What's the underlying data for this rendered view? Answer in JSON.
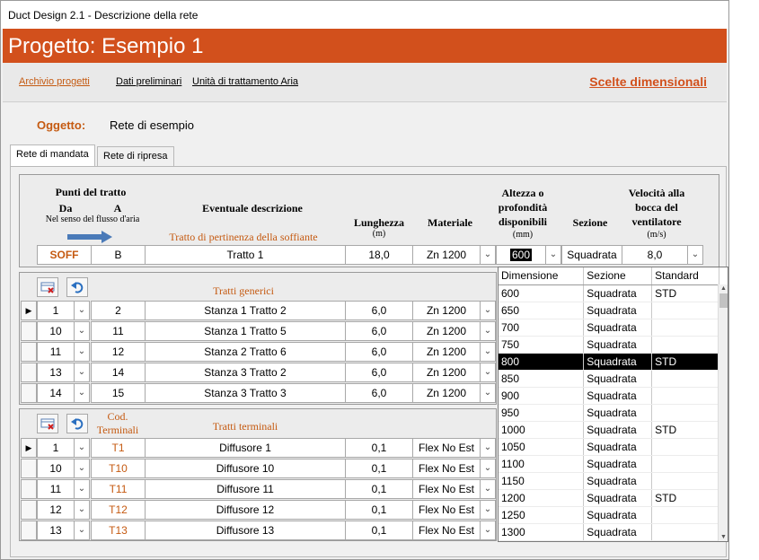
{
  "window": {
    "title": "Duct Design 2.1 - Descrizione della rete"
  },
  "banner": {
    "title": "Progetto: Esempio 1"
  },
  "nav": {
    "items": [
      "Archivio progetti",
      "Dati preliminari",
      "Unità di trattamento Aria"
    ],
    "right": "Scelte dimensionali"
  },
  "oggetto": {
    "label": "Oggetto:",
    "value": "Rete di esempio"
  },
  "tabs": [
    "Rete di mandata",
    "Rete di ripresa"
  ],
  "header": {
    "punti": "Punti del tratto",
    "da": "Da",
    "a": "A",
    "senso": "Nel senso del flusso d'aria",
    "descrizione": "Eventuale descrizione",
    "pertinenza": "Tratto di pertinenza della soffiante",
    "lunghezza": "Lunghezza",
    "lunghezza_unit": "(m)",
    "materiale": "Materiale",
    "altezza": "Altezza o profondità disponibili",
    "altezza_unit": "(mm)",
    "sezione": "Sezione",
    "velocita": "Velocità alla bocca del ventilatore",
    "velocita_unit": "(m/s)"
  },
  "fan_row": {
    "da": "SOFF",
    "a": "B",
    "descrizione": "Tratto 1",
    "lunghezza": "18,0",
    "materiale": "Zn 1200",
    "altezza": "600",
    "sezione": "Squadrata",
    "velocita": "8,0"
  },
  "generici": {
    "title": "Tratti generici",
    "rows": [
      {
        "da": "1",
        "a": "2",
        "desc": "Stanza 1 Tratto 2",
        "len": "6,0",
        "mat": "Zn 1200"
      },
      {
        "da": "10",
        "a": "11",
        "desc": "Stanza 1 Tratto 5",
        "len": "6,0",
        "mat": "Zn 1200"
      },
      {
        "da": "11",
        "a": "12",
        "desc": "Stanza 2 Tratto 6",
        "len": "6,0",
        "mat": "Zn 1200"
      },
      {
        "da": "13",
        "a": "14",
        "desc": "Stanza 3 Tratto 2",
        "len": "6,0",
        "mat": "Zn 1200"
      },
      {
        "da": "14",
        "a": "15",
        "desc": "Stanza 3 Tratto 3",
        "len": "6,0",
        "mat": "Zn 1200"
      }
    ]
  },
  "terminali": {
    "title": "Tratti terminali",
    "cod": "Cod. Terminali",
    "rows": [
      {
        "da": "1",
        "cod": "T1",
        "desc": "Diffusore 1",
        "val": "0,1",
        "tipo": "Flex No Est"
      },
      {
        "da": "10",
        "cod": "T10",
        "desc": "Diffusore 10",
        "val": "0,1",
        "tipo": "Flex No Est"
      },
      {
        "da": "11",
        "cod": "T11",
        "desc": "Diffusore 11",
        "val": "0,1",
        "tipo": "Flex No Est"
      },
      {
        "da": "12",
        "cod": "T12",
        "desc": "Diffusore 12",
        "val": "0,1",
        "tipo": "Flex No Est"
      },
      {
        "da": "13",
        "cod": "T13",
        "desc": "Diffusore 13",
        "val": "0,1",
        "tipo": "Flex No Est"
      }
    ]
  },
  "dropdown": {
    "columns": [
      "Dimensione",
      "Sezione",
      "Standard"
    ],
    "rows": [
      [
        "600",
        "Squadrata",
        "STD"
      ],
      [
        "650",
        "Squadrata",
        ""
      ],
      [
        "700",
        "Squadrata",
        ""
      ],
      [
        "750",
        "Squadrata",
        ""
      ],
      [
        "800",
        "Squadrata",
        "STD"
      ],
      [
        "850",
        "Squadrata",
        ""
      ],
      [
        "900",
        "Squadrata",
        ""
      ],
      [
        "950",
        "Squadrata",
        ""
      ],
      [
        "1000",
        "Squadrata",
        "STD"
      ],
      [
        "1050",
        "Squadrata",
        ""
      ],
      [
        "1100",
        "Squadrata",
        ""
      ],
      [
        "1150",
        "Squadrata",
        ""
      ],
      [
        "1200",
        "Squadrata",
        "STD"
      ],
      [
        "1250",
        "Squadrata",
        ""
      ],
      [
        "1300",
        "Squadrata",
        ""
      ]
    ],
    "selected": "800"
  },
  "icons": {
    "delete": "delete-record-icon",
    "undo": "undo-icon",
    "arrow": "flow-arrow-icon",
    "chevron": "chevron-down-icon",
    "row": "row-pointer-icon"
  }
}
